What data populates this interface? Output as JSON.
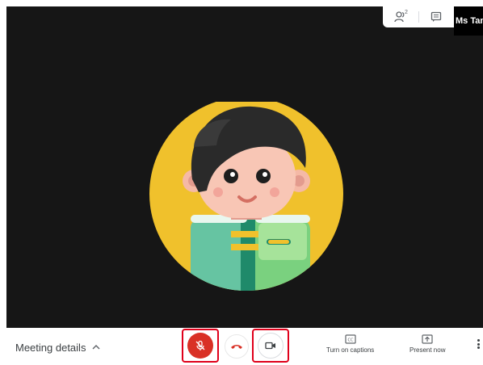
{
  "stage": {
    "user_name": "Ms Tan",
    "people_count": "2"
  },
  "icons": {
    "people": "people-icon",
    "chat": "chat-icon",
    "mic_off": "mic-off-icon",
    "hang_up": "call-end-icon",
    "camera": "videocam-icon",
    "captions": "closed-caption-icon",
    "present": "present-to-all-icon",
    "more": "more-vert-icon"
  },
  "colors": {
    "mic_off_bg": "#d93025",
    "hang_up": "#d93025",
    "highlight_outline": "#e0001b",
    "stage_bg": "#161616"
  },
  "bottom_bar": {
    "meeting_details_label": "Meeting details",
    "captions_label": "Turn on captions",
    "present_label": "Present now"
  }
}
